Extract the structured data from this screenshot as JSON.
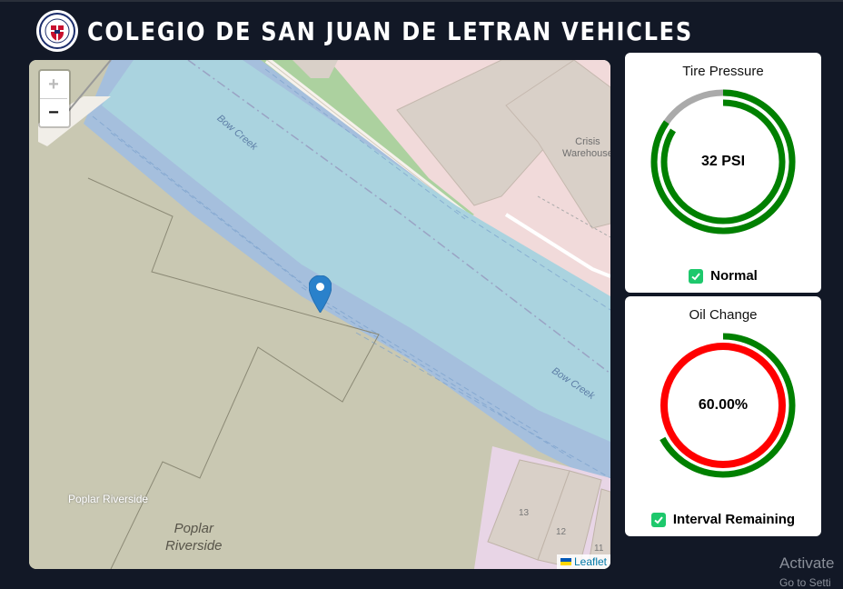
{
  "header": {
    "title": "COLEGIO DE SAN JUAN DE LETRAN VEHICLES"
  },
  "map": {
    "zoom_in_label": "+",
    "zoom_out_label": "−",
    "labels": {
      "river_upper": "Bow Creek",
      "river_lower": "Bow Creek",
      "building": "Crisis\nWarehouse",
      "place_small": "Poplar Riverside",
      "place_large": "Poplar\nRiverside",
      "num_13": "13",
      "num_12": "12",
      "num_11": "11"
    },
    "attribution": "Leaflet"
  },
  "tire_pressure": {
    "title": "Tire Pressure",
    "value_text": "32 PSI",
    "status": "Normal",
    "colors": {
      "track": "#aaaaaa",
      "progress": "#008000"
    }
  },
  "oil_change": {
    "title": "Oil Change",
    "value_text": "60.00%",
    "percent": 60,
    "status": "Interval Remaining",
    "colors": {
      "outer": "#008000",
      "inner": "#ff0000"
    }
  },
  "watermark": {
    "line1": "Activate",
    "line2": "Go to Setti"
  }
}
